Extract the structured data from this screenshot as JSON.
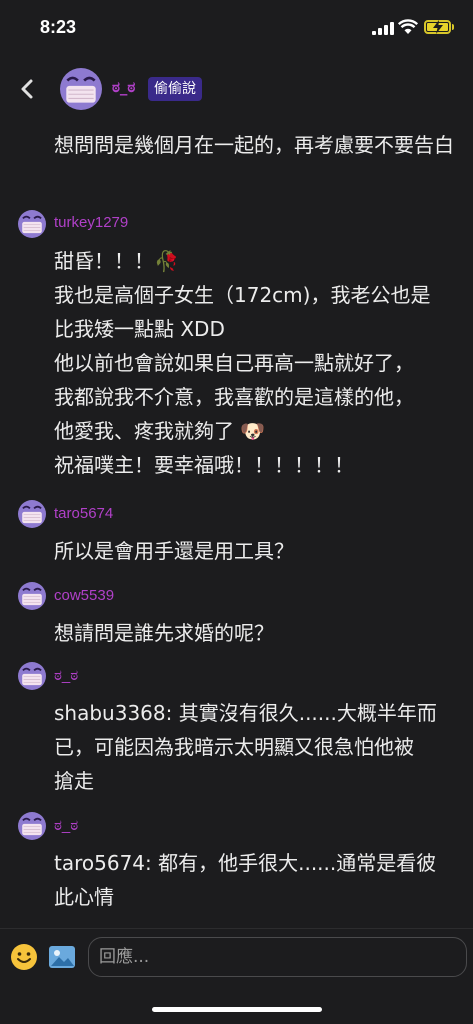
{
  "status_bar": {
    "time": "8:23"
  },
  "header": {
    "name": "ಠ_ಠ",
    "badge": "偷偷說"
  },
  "prev_message_tail": "想問問是幾個月在一起的，再考慮要不要告白",
  "messages": [
    {
      "user": "turkey1279",
      "lines": [
        "甜昏！！！🥀",
        "我也是高個子女生（172cm)，我老公也是",
        "比我矮一點點 XDD",
        "他以前也會說如果自己再高一點就好了，",
        "我都說我不介意，我喜歡的是這樣的他，",
        "他愛我、疼我就夠了 🐶",
        "祝福噗主！要幸福哦！！！！！！"
      ]
    },
    {
      "user": "taro5674",
      "lines": [
        "所以是會用手還是用工具？"
      ]
    },
    {
      "user": "cow5539",
      "lines": [
        "想請問是誰先求婚的呢？"
      ]
    },
    {
      "user": "ಠ_ಠ",
      "lines": [
        "shabu3368: 其實沒有很久......大概半年而",
        "已，可能因為我暗示太明顯又很急怕他被",
        "搶走"
      ]
    },
    {
      "user": "ಠ_ಠ",
      "lines": [
        "taro5674: 都有，他手很大......通常是看彼",
        "此心情"
      ]
    }
  ],
  "reply": {
    "placeholder": "回應..."
  }
}
